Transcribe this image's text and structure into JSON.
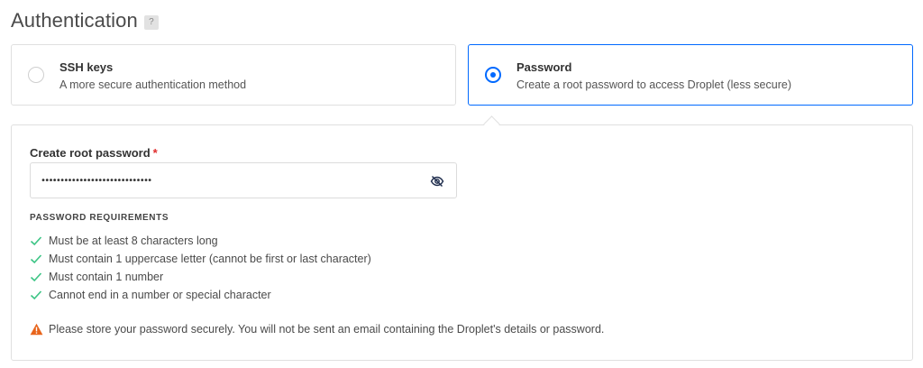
{
  "section": {
    "title": "Authentication",
    "help": "?"
  },
  "options": [
    {
      "title": "SSH keys",
      "description": "A more secure authentication method",
      "selected": false
    },
    {
      "title": "Password",
      "description": "Create a root password to access Droplet (less secure)",
      "selected": true
    }
  ],
  "password": {
    "label": "Create root password",
    "required_mark": "*",
    "value": "•••••••••••••••••••••••••••••",
    "toggle_icon": "eye-slash-icon"
  },
  "requirements": {
    "heading": "PASSWORD REQUIREMENTS",
    "items": [
      "Must be at least 8 characters long",
      "Must contain 1 uppercase letter (cannot be first or last character)",
      "Must contain 1 number",
      "Cannot end in a number or special character"
    ],
    "check_icon": "checkmark-icon",
    "check_color": "#3bc484"
  },
  "warning": {
    "icon": "warning-triangle-icon",
    "color": "#e8641b",
    "text": "Please store your password securely. You will not be sent an email containing the Droplet's details or password."
  },
  "colors": {
    "accent": "#0069ff",
    "required": "#e02d2d"
  }
}
